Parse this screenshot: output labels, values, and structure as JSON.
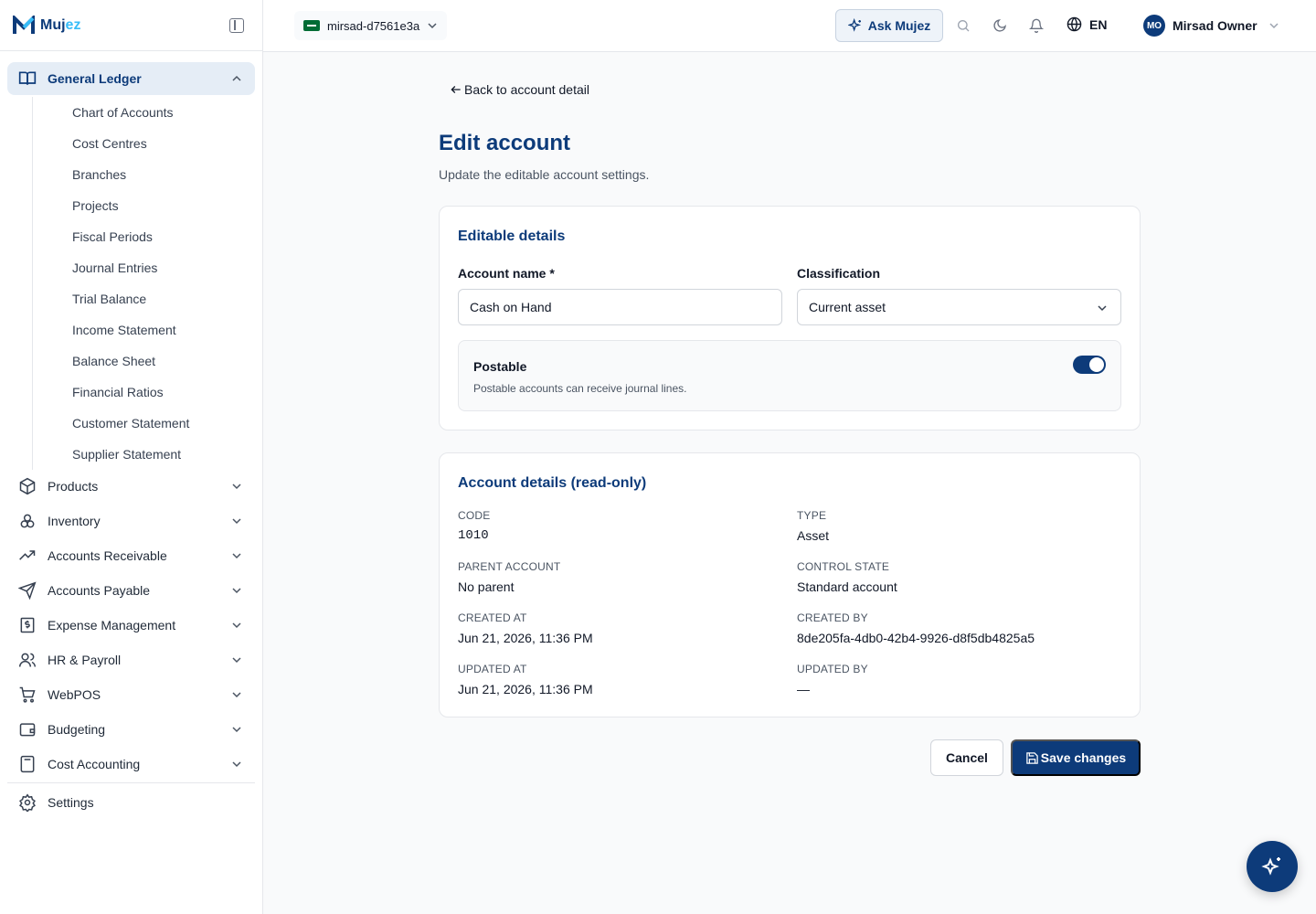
{
  "brand": {
    "name_main": "Muj",
    "name_accent": "ez"
  },
  "sidebar": {
    "active_group": {
      "label": "General Ledger",
      "icon": "book-open-icon"
    },
    "sub_items": [
      "Chart of Accounts",
      "Cost Centres",
      "Branches",
      "Projects",
      "Fiscal Periods",
      "Journal Entries",
      "Trial Balance",
      "Income Statement",
      "Balance Sheet",
      "Financial Ratios",
      "Customer Statement",
      "Supplier Statement"
    ],
    "groups": [
      {
        "label": "Products",
        "icon": "package-icon"
      },
      {
        "label": "Inventory",
        "icon": "boxes-icon"
      },
      {
        "label": "Accounts Receivable",
        "icon": "trending-up-icon"
      },
      {
        "label": "Accounts Payable",
        "icon": "send-icon"
      },
      {
        "label": "Expense Management",
        "icon": "receipt-dollar-icon"
      },
      {
        "label": "HR & Payroll",
        "icon": "users-icon"
      },
      {
        "label": "WebPOS",
        "icon": "cart-icon"
      },
      {
        "label": "Budgeting",
        "icon": "wallet-icon"
      },
      {
        "label": "Cost Accounting",
        "icon": "calculator-icon"
      }
    ],
    "settings": {
      "label": "Settings",
      "icon": "gear-icon"
    }
  },
  "topbar": {
    "org_name": "mirsad-d7561e3a",
    "ask_label": "Ask Mujez",
    "language": "EN",
    "user_initials": "MO",
    "user_name": "Mirsad Owner"
  },
  "page": {
    "back_label": "Back to account detail",
    "title": "Edit account",
    "subtitle": "Update the editable account settings."
  },
  "editable": {
    "title": "Editable details",
    "account_name_label": "Account name *",
    "account_name_value": "Cash on Hand",
    "classification_label": "Classification",
    "classification_value": "Current asset",
    "postable_title": "Postable",
    "postable_desc": "Postable accounts can receive journal lines.",
    "postable_on": true
  },
  "readonly": {
    "title": "Account details (read-only)",
    "code_label": "CODE",
    "code_value": "1010",
    "type_label": "TYPE",
    "type_value": "Asset",
    "parent_label": "PARENT ACCOUNT",
    "parent_value": "No parent",
    "control_label": "CONTROL STATE",
    "control_value": "Standard account",
    "created_at_label": "CREATED AT",
    "created_at_value": "Jun 21, 2026, 11:36 PM",
    "created_by_label": "CREATED BY",
    "created_by_value": "8de205fa-4db0-42b4-9926-d8f5db4825a5",
    "updated_at_label": "UPDATED AT",
    "updated_at_value": "Jun 21, 2026, 11:36 PM",
    "updated_by_label": "UPDATED BY",
    "updated_by_value": "—"
  },
  "actions": {
    "cancel_label": "Cancel",
    "save_label": "Save changes"
  },
  "colors": {
    "brand": "#0d3b7a",
    "accent": "#38bdf8",
    "active_bg": "#e5edf6"
  }
}
